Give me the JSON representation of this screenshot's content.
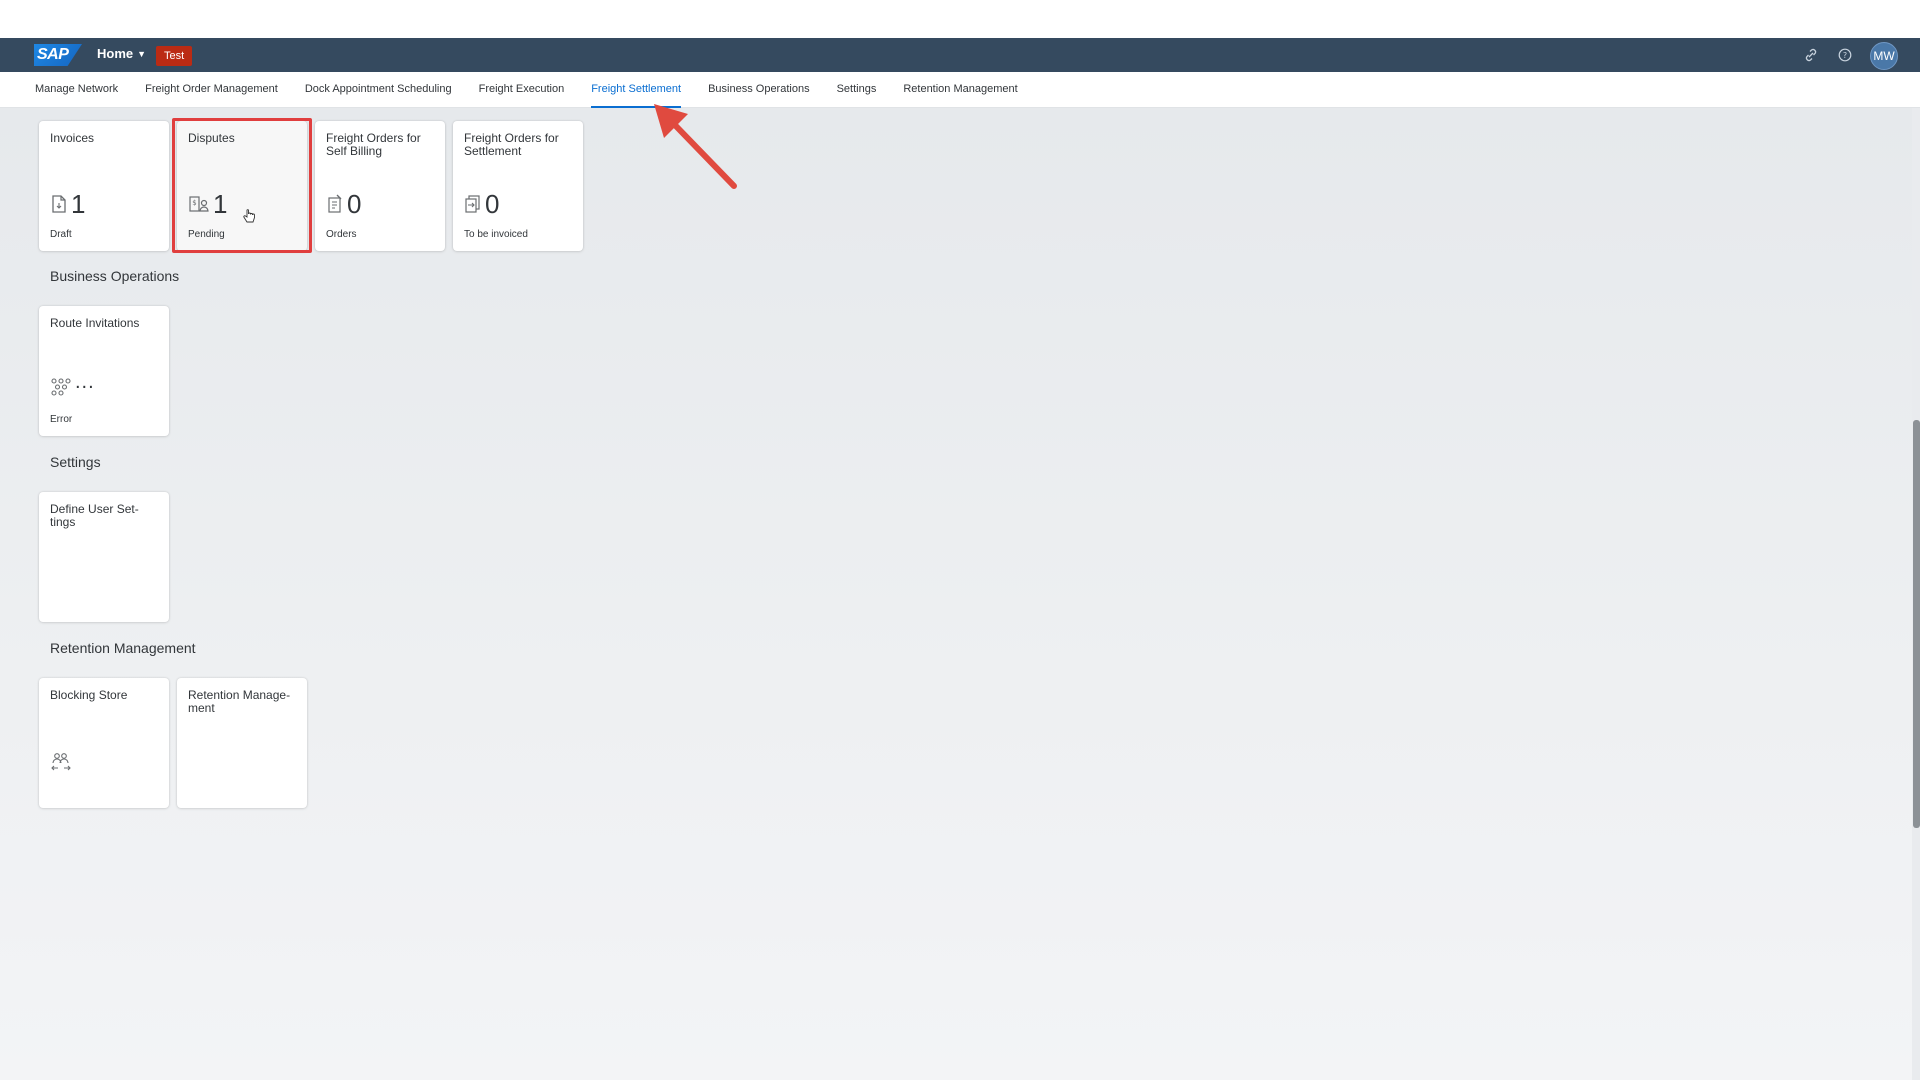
{
  "shell": {
    "logo_text": "SAP",
    "home_label": "Home",
    "environment_badge": "Test",
    "user_initials": "MW",
    "icons": [
      "link-icon",
      "help-icon"
    ],
    "colors": {
      "shellbar": "#354a5f",
      "badge": "#bb2b14",
      "accent": "#0a6ed1",
      "highlight": "#e03e3e"
    }
  },
  "tabs": [
    {
      "label": "Manage Network"
    },
    {
      "label": "Freight Order Management"
    },
    {
      "label": "Dock Appointment Scheduling"
    },
    {
      "label": "Freight Execution"
    },
    {
      "label": "Freight Settlement",
      "active": true
    },
    {
      "label": "Business Operations"
    },
    {
      "label": "Settings"
    },
    {
      "label": "Retention Management"
    }
  ],
  "freight_settlement": {
    "tiles": [
      {
        "title": "Invoices",
        "value": "1",
        "footer": "Draft",
        "icon": "document-icon"
      },
      {
        "title": "Disputes",
        "value": "1",
        "footer": "Pending",
        "icon": "dispute-icon"
      },
      {
        "title": "Freight Orders for Self Billing",
        "value": "0",
        "footer": "Orders",
        "icon": "billing-document-icon"
      },
      {
        "title": "Freight Orders for Settlement",
        "value": "0",
        "footer": "To be invoiced",
        "icon": "settlement-document-icon"
      }
    ]
  },
  "business_operations": {
    "title": "Business Operations",
    "tiles": [
      {
        "title": "Route Invitations",
        "value": "...",
        "footer": "Error",
        "icon": "network-icon"
      }
    ]
  },
  "settings": {
    "title": "Settings",
    "tiles": [
      {
        "title": "Define User Set- tings"
      }
    ]
  },
  "retention_management": {
    "title": "Retention Management",
    "tiles": [
      {
        "title": "Blocking Store",
        "icon": "user-group-transfer-icon"
      },
      {
        "title": "Retention Manage- ment"
      }
    ]
  }
}
